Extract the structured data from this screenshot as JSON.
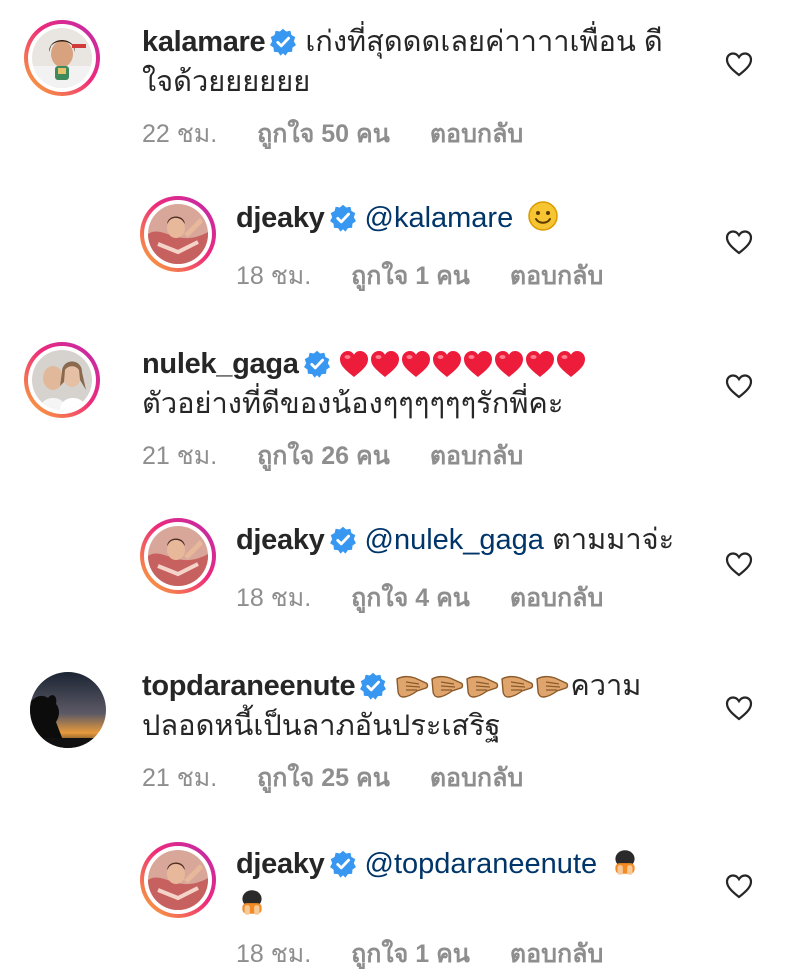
{
  "comments": [
    {
      "username": "kalamare",
      "text_line1": "เก่งที่สุดดดเลยค่าาาาเพื่อน ดี",
      "text_line2": "ใจด้วยยยยยย",
      "time": "22 ชม.",
      "likes": "ถูกใจ 50 คน",
      "reply": "ตอบกลับ"
    },
    {
      "username": "djeaky",
      "mention": "@kalamare",
      "emoji": "smile-emoji",
      "time": "18 ชม.",
      "likes": "ถูกใจ 1 คน",
      "reply": "ตอบกลับ"
    },
    {
      "username": "nulek_gaga",
      "emoji_count": 8,
      "emoji": "red-heart-emoji",
      "text_line2": "ตัวอย่างที่ดีของน้องๆๆๆๆๆๆรักพี่คะ",
      "time": "21 ชม.",
      "likes": "ถูกใจ 26 คน",
      "reply": "ตอบกลับ"
    },
    {
      "username": "djeaky",
      "mention": "@nulek_gaga",
      "text": "ตามมาจ่ะ",
      "time": "18 ชม.",
      "likes": "ถูกใจ 4 คน",
      "reply": "ตอบกลับ"
    },
    {
      "username": "topdaraneenute",
      "emoji_count": 5,
      "emoji": "praising-hands-emoji",
      "text_line1": "ความ",
      "text_line2": "ปลอดหนี้เป็นลาภอันประเสริฐ",
      "time": "21 ชม.",
      "likes": "ถูกใจ 25 คน",
      "reply": "ตอบกลับ"
    },
    {
      "username": "djeaky",
      "mention": "@topdaraneenute",
      "emoji": "person-bowing-emoji",
      "time": "18 ชม.",
      "likes": "ถูกใจ 1 คน",
      "reply": "ตอบกลับ"
    }
  ],
  "colors": {
    "verified": "#3897f0",
    "mention": "#003569",
    "meta": "#8e8e8e",
    "heart_red": "#ed1c3b"
  }
}
